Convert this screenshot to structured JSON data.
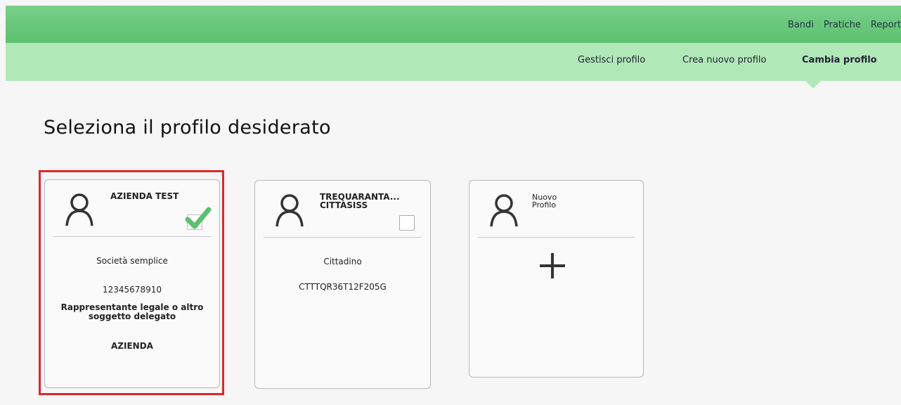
{
  "topnav": {
    "items": [
      "Bandi",
      "Pratiche",
      "Report"
    ]
  },
  "subnav": {
    "items": [
      "Gestisci profilo",
      "Crea nuovo profilo",
      "Cambia profilo"
    ],
    "active": "Cambia profilo"
  },
  "page": {
    "title": "Seleziona il profilo desiderato"
  },
  "colors": {
    "header": "#5cc070",
    "subheader": "#b0e8b8",
    "highlight": "#e0262b",
    "check": "#5cc070"
  },
  "cards": [
    {
      "title": "AZIENDA TEST",
      "selected": true,
      "type": "Società semplice",
      "code": "12345678910",
      "role": "Rappresentante legale o altro soggetto delegato",
      "category": "AZIENDA",
      "icon": "user-icon"
    },
    {
      "title": "TREQUARANTA...\nCITTASISS",
      "selected": false,
      "type": "Cittadino",
      "code": "CTTTQR36T12F205G",
      "icon": "user-icon"
    },
    {
      "title": "Nuovo\nProfilo",
      "icon": "user-icon",
      "action_icon": "plus-icon"
    }
  ]
}
